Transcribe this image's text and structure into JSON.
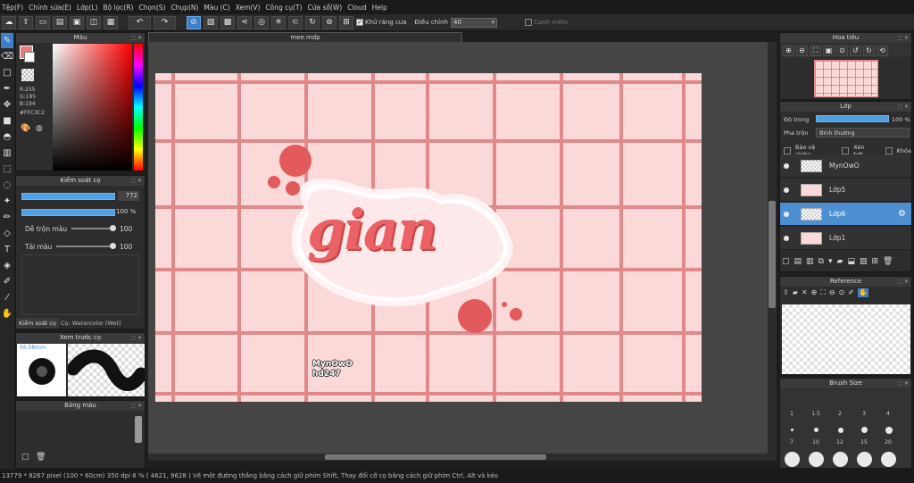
{
  "menu": [
    "Tệp(F)",
    "Chỉnh sửa(E)",
    "Lớp(L)",
    "Bộ lọc(R)",
    "Chọn(S)",
    "Chụp(N)",
    "Màu (C)",
    "Xem(V)",
    "Công cụ(T)",
    "Cửa sổ(W)",
    "Cloud",
    "Help"
  ],
  "toolbar": {
    "antialias_label": "Khử răng cưa",
    "adjust_label": "Điều chỉnh",
    "adjust_value": "40",
    "soft_edge_label": "Cạnh mềm"
  },
  "color_panel": {
    "title": "Màu",
    "r": "R:255",
    "g": "G:195",
    "b": "B:194",
    "hex": "#FFC3C2",
    "accent": "#FFC3C2"
  },
  "brush_control": {
    "title": "Kiểm soát cọ",
    "size_value": "772",
    "opacity_value": "100 %",
    "blend_label": "Dễ trộn màu",
    "blend_value": "100",
    "reload_label": "Tải màu",
    "reload_value": "100",
    "tab_active": "Kiểm soát cọ",
    "tab_brush": "Cọ: Watercolor (Wet)"
  },
  "preview_panel": {
    "title": "Xem trước cọ",
    "size_text": "56.08mm"
  },
  "palette_panel": {
    "title": "Bảng màu"
  },
  "document": {
    "tab": "mee.mdp"
  },
  "artwork": {
    "word": "gian",
    "sign_line1": "MynOwO",
    "sign_line2": "hd247"
  },
  "navigator": {
    "title": "Hoa tiêu"
  },
  "layers_panel": {
    "title": "Lớp",
    "opacity_label": "Độ trong",
    "opacity_value": "100 %",
    "blend_label": "Pha trộn",
    "blend_value": "Bình thường",
    "protect_alpha": "Bảo vệ alpha",
    "clipping": "Xén bớt",
    "lock": "Khóa",
    "layers": [
      {
        "name": "MynOwO"
      },
      {
        "name": "Lớp5"
      },
      {
        "name": "Lớp6"
      },
      {
        "name": "Lớp1"
      }
    ]
  },
  "reference_panel": {
    "title": "Reference"
  },
  "brush_size_panel": {
    "title": "Brush Size",
    "row1": [
      "1",
      "1.5",
      "2",
      "3",
      "4"
    ],
    "row2": [
      "7",
      "10",
      "12",
      "15",
      "20"
    ]
  },
  "status_bar": "13779 * 8267 pixel  (100 * 60cm)  350 dpi  8 %  ( 4621, 9628 )  Vẽ một đường thẳng bằng cách giữ phím Shift, Thay đổi cỡ cọ bằng cách giữ phím Ctrl, Alt và kéo"
}
